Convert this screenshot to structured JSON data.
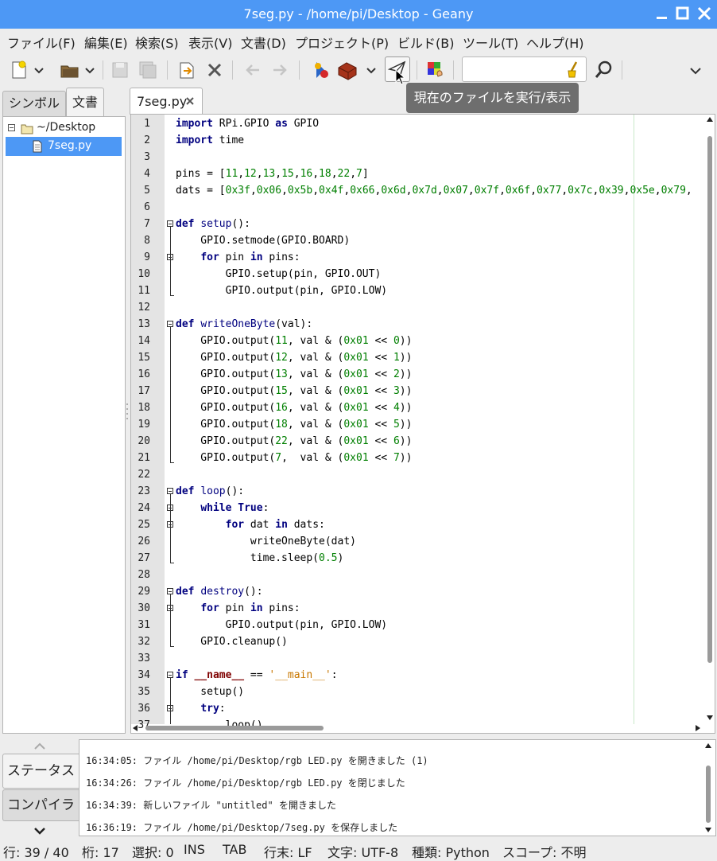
{
  "window": {
    "title": "7seg.py - /home/pi/Desktop - Geany",
    "controls": [
      "minimize-icon",
      "maximize-icon",
      "close-icon"
    ]
  },
  "menubar": [
    "ファイル(F)",
    "編集(E)",
    "検索(S)",
    "表示(V)",
    "文書(D)",
    "プロジェクト(P)",
    "ビルド(B)",
    "ツール(T)",
    "ヘルプ(H)"
  ],
  "toolbar": {
    "icons": [
      "new-file-icon",
      "new-dropdown-icon",
      "open-file-icon",
      "open-dropdown-icon",
      "save-icon",
      "save-all-icon",
      "revert-icon",
      "close-file-icon",
      "back-icon",
      "forward-icon",
      "compile-icon",
      "build-icon",
      "build-dropdown-icon",
      "execute-icon",
      "color-chooser-icon",
      "clear-search-icon",
      "find-icon",
      "overflow-icon"
    ],
    "search_value": "",
    "tooltip": "現在のファイルを実行/表示"
  },
  "sidebar": {
    "tabs": [
      "シンボル",
      "文書"
    ],
    "active_tab": "文書",
    "tree": {
      "folder": "~/Desktop",
      "file": "7seg.py"
    }
  },
  "editor": {
    "tab_label": "7seg.py",
    "lines": [
      "import RPi.GPIO as GPIO",
      "import time",
      "",
      "pins = [11,12,13,15,16,18,22,7]",
      "dats = [0x3f,0x06,0x5b,0x4f,0x66,0x6d,0x7d,0x07,0x7f,0x6f,0x77,0x7c,0x39,0x5e,0x79,",
      "",
      "def setup():",
      "    GPIO.setmode(GPIO.BOARD)",
      "    for pin in pins:",
      "        GPIO.setup(pin, GPIO.OUT)",
      "        GPIO.output(pin, GPIO.LOW)",
      "",
      "def writeOneByte(val):",
      "    GPIO.output(11, val & (0x01 << 0))",
      "    GPIO.output(12, val & (0x01 << 1))",
      "    GPIO.output(13, val & (0x01 << 2))",
      "    GPIO.output(15, val & (0x01 << 3))",
      "    GPIO.output(16, val & (0x01 << 4))",
      "    GPIO.output(18, val & (0x01 << 5))",
      "    GPIO.output(22, val & (0x01 << 6))",
      "    GPIO.output(7,  val & (0x01 << 7))",
      "",
      "def loop():",
      "    while True:",
      "        for dat in dats:",
      "            writeOneByte(dat)",
      "            time.sleep(0.5)",
      "",
      "def destroy():",
      "    for pin in pins:",
      "        GPIO.output(pin, GPIO.LOW)",
      "    GPIO.cleanup()",
      "",
      "if __name__ == '__main__':",
      "    setup()",
      "    try:",
      "        loop()"
    ]
  },
  "bottom_panel": {
    "tabs": [
      "ステータス",
      "コンパイラ"
    ],
    "messages": [
      "16:34:05: ファイル /home/pi/Desktop/rgb LED.py を開きました (1)",
      "16:34:26: ファイル /home/pi/Desktop/rgb LED.py を閉じました",
      "16:34:39: 新しいファイル \"untitled\" を開きました",
      "16:36:19: ファイル /home/pi/Desktop/7seg.py を保存しました"
    ]
  },
  "statusbar": {
    "line": "行: 39 / 40",
    "col": "桁: 17",
    "sel": "選択: 0",
    "mode": "INS",
    "indent": "TAB",
    "eol": "行末: LF",
    "encoding": "文字: UTF-8",
    "filetype": "種類: Python",
    "scope": "スコープ: 不明"
  }
}
